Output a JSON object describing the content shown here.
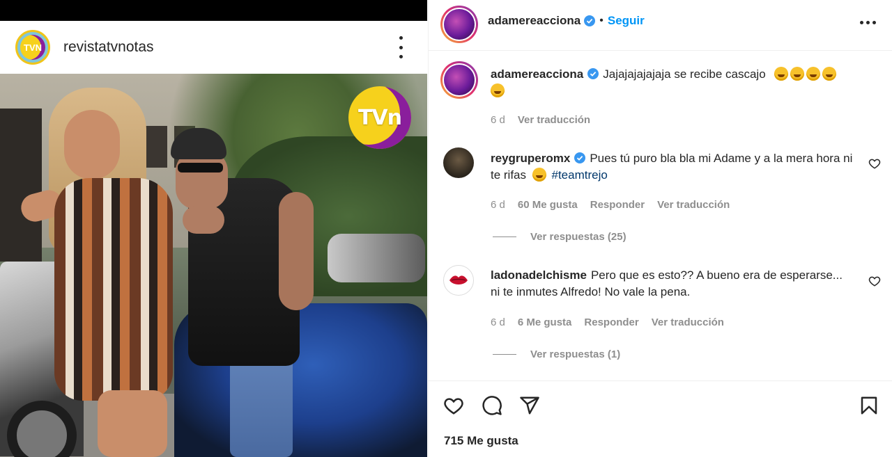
{
  "embed": {
    "username": "revistatvnotas",
    "avatar_text": "TVN",
    "photo_badge": "TVn"
  },
  "post": {
    "author": "adamereacciona",
    "follow_label": "Seguir",
    "separator": "•",
    "caption_text": "Jajajajajajaja se recibe cascajo",
    "caption_time": "6 d",
    "caption_translate": "Ver traducción"
  },
  "comments": [
    {
      "username": "reygruperomx",
      "verified": true,
      "text": "Pues tú puro bla bla mi Adame y a la mera hora ni te rifas",
      "hashtag": "#teamtrejo",
      "time": "6 d",
      "likes": "60 Me gusta",
      "reply": "Responder",
      "translate": "Ver traducción",
      "view_replies": "Ver respuestas (25)"
    },
    {
      "username": "ladonadelchisme",
      "verified": false,
      "text": "Pero que es esto?? A bueno era de esperarse... ni te inmutes Alfredo! No vale la pena.",
      "time": "6 d",
      "likes": "6 Me gusta",
      "reply": "Responder",
      "translate": "Ver traducción",
      "view_replies": "Ver respuestas (1)"
    }
  ],
  "footer": {
    "likes_count": "715 Me gusta"
  },
  "icons": {
    "like": "heart-icon",
    "comment": "comment-icon",
    "share": "send-icon",
    "save": "bookmark-icon",
    "more": "more-icon",
    "verified": "verified-badge-icon"
  },
  "colors": {
    "follow_blue": "#0095f6",
    "verified_blue": "#3897f0",
    "hashtag": "#00376b",
    "muted": "#8e8e8e"
  }
}
